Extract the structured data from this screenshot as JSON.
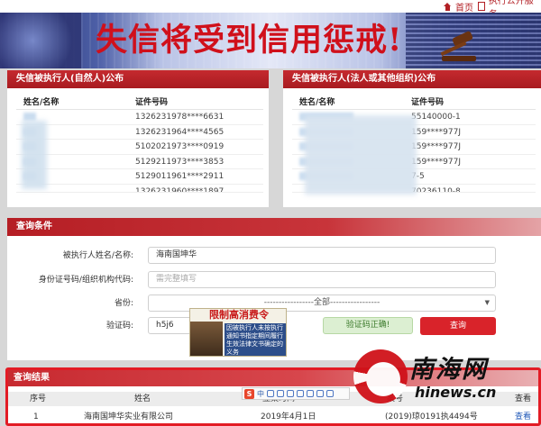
{
  "topbar": {
    "home_label": "首页",
    "publish_label": "执行公开服务"
  },
  "banner": {
    "title": "失信将受到信用惩戒!"
  },
  "left_panel": {
    "title": "失信被执行人(自然人)公布",
    "headers": [
      "姓名/名称",
      "证件号码"
    ],
    "rows": [
      {
        "name": "",
        "id": "1326231978****6631"
      },
      {
        "name": "",
        "id": "1326231964****4565"
      },
      {
        "name": "",
        "id": "5102021973****0919"
      },
      {
        "name": "",
        "id": "5129211973****3853"
      },
      {
        "name": "",
        "id": "5129011961****2911"
      },
      {
        "name": "",
        "id": "1326231960****1897"
      }
    ]
  },
  "right_panel": {
    "title": "失信被执行人(法人或其他组织)公布",
    "headers": [
      "姓名/名称",
      "证件号码"
    ],
    "rows": [
      {
        "name": "",
        "id": "55140000-1"
      },
      {
        "name": "",
        "id": "159****977J"
      },
      {
        "name": "",
        "id": "159****977J"
      },
      {
        "name": "",
        "id": "159****977J"
      },
      {
        "name": "",
        "id": "7-5"
      },
      {
        "name": "",
        "id": "70236110-8"
      }
    ]
  },
  "query": {
    "title": "查询条件",
    "name_label": "被执行人姓名/名称:",
    "name_value": "海南国坤华",
    "id_label": "身份证号码/组织机构代码:",
    "id_placeholder": "需完整填写",
    "province_label": "省份:",
    "province_value": "-----------------全部-----------------",
    "captcha_label": "验证码:",
    "captcha_value": "h5j6",
    "captcha_ok": "验证码正确!",
    "query_button": "查询"
  },
  "ad": {
    "title": "限制高消费令",
    "text": "因被执行人未按执行通知书指定期间履行生效法律文书确定的义务"
  },
  "results": {
    "title": "查询结果",
    "headers": [
      "序号",
      "姓名",
      "立案时间",
      "案号",
      "查看"
    ],
    "rows": [
      {
        "no": "1",
        "name": "海南国坤华实业有限公司",
        "date": "2019年4月1日",
        "case": "(2019)琼0191执4494号",
        "view": "查看"
      }
    ]
  },
  "ime": {
    "badge": "S",
    "lang": "中"
  },
  "watermark": {
    "title": "南海网",
    "url": "hinews.cn"
  }
}
